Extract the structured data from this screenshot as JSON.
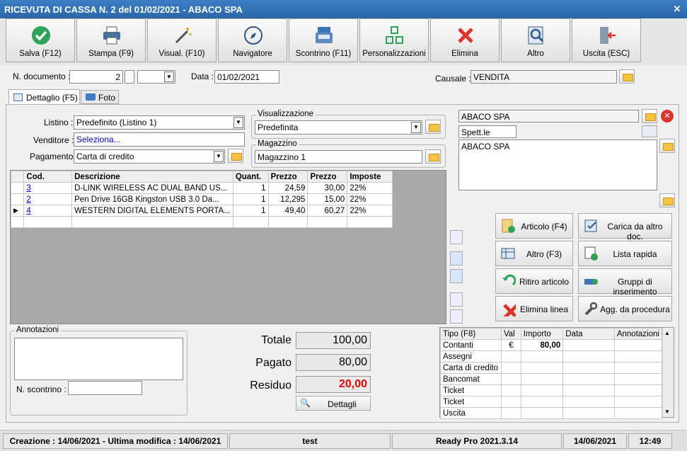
{
  "window": {
    "title": "RICEVUTA DI CASSA N. 2 del 01/02/2021 - ABACO SPA",
    "close": "✕"
  },
  "toolbar": [
    {
      "name": "save-button",
      "icon": "check-icon",
      "label": "Salva (F12)"
    },
    {
      "name": "print-button",
      "icon": "printer-icon",
      "label": "Stampa (F9)"
    },
    {
      "name": "visual-button",
      "icon": "wand-icon",
      "label": "Visual. (F10)"
    },
    {
      "name": "navigator-button",
      "icon": "compass-icon",
      "label": "Navigatore"
    },
    {
      "name": "receipt-button",
      "icon": "cash-register-icon",
      "label": "Scontrino (F11)"
    },
    {
      "name": "customize-button",
      "icon": "grid-icon",
      "label": "Personalizzazioni"
    },
    {
      "name": "delete-button",
      "icon": "x-icon",
      "label": "Elimina"
    },
    {
      "name": "other-button",
      "icon": "magnifier-icon",
      "label": "Altro"
    },
    {
      "name": "exit-button",
      "icon": "exit-door-icon",
      "label": "Uscita (ESC)"
    }
  ],
  "header": {
    "doc_label": "N. documento :",
    "doc_number": "2",
    "date_label": "Data :",
    "date": "01/02/2021",
    "causale_label": "Causale :",
    "causale": "VENDITA"
  },
  "tabs": [
    {
      "label": "Dettaglio (F5)"
    },
    {
      "label": "Foto"
    }
  ],
  "form": {
    "listino_label": "Listino :",
    "listino": "Predefinito (Listino 1)",
    "venditore_label": "Venditore :",
    "venditore": "Seleziona...",
    "pagamento_label": "Pagamento :",
    "pagamento": "Carta di credito",
    "visualizzazione_label": "Visualizzazione",
    "visualizzazione": "Predefinita",
    "magazzino_label": "Magazzino",
    "magazzino": "Magazzino 1"
  },
  "customer": {
    "name": "ABACO SPA",
    "salutation": "Spett.le",
    "address": "ABACO SPA"
  },
  "grid": {
    "headers": [
      "Cod.",
      "Descrizione",
      "Quant.",
      "Prezzo",
      "Prezzo",
      "Imposte"
    ],
    "rows": [
      {
        "code": "3",
        "desc": "D-LINK WIRELESS AC DUAL BAND US...",
        "qty": "1",
        "price": "24,59",
        "price2": "30,00",
        "tax": "22%"
      },
      {
        "code": "2",
        "desc": "Pen Drive 16GB  Kingston  USB 3.0 Da...",
        "qty": "1",
        "price": "12,295",
        "price2": "15,00",
        "tax": "22%"
      },
      {
        "code": "4",
        "desc": "WESTERN DIGITAL ELEMENTS PORTA...",
        "qty": "1",
        "price": "49,40",
        "price2": "60,27",
        "tax": "22%"
      }
    ]
  },
  "actions": [
    {
      "name": "add-article-button",
      "icon": "article-icon",
      "label": "Articolo (F4)"
    },
    {
      "name": "load-from-doc-button",
      "icon": "checklist-icon",
      "label": "Carica da altro doc."
    },
    {
      "name": "other-action-button",
      "icon": "table-icon",
      "label": "Altro (F3)"
    },
    {
      "name": "quick-list-button",
      "icon": "list-add-icon",
      "label": "Lista rapida"
    },
    {
      "name": "return-article-button",
      "icon": "return-icon",
      "label": "Ritiro articolo"
    },
    {
      "name": "insert-groups-button",
      "icon": "group-icon",
      "label": "Gruppi di inserimento"
    },
    {
      "name": "delete-line-button",
      "icon": "x-icon",
      "label": "Elimina linea"
    },
    {
      "name": "add-by-procedure-button",
      "icon": "wrench-icon",
      "label": "Agg. da procedura"
    }
  ],
  "notes": {
    "title": "Annotazioni",
    "scontrino_label": "N. scontrino :"
  },
  "totals": {
    "totale_label": "Totale",
    "totale": "100,00",
    "pagato_label": "Pagato",
    "pagato": "80,00",
    "residuo_label": "Residuo",
    "residuo": "20,00",
    "details_label": "Dettagli"
  },
  "payments": {
    "headers": [
      "Tipo (F8)",
      "Val",
      "Importo",
      "Data",
      "Annotazioni"
    ],
    "rows": [
      {
        "type": "Contanti",
        "val": "€",
        "amount": "80,00"
      },
      {
        "type": "Assegni",
        "val": "",
        "amount": ""
      },
      {
        "type": "Carta di credito",
        "val": "",
        "amount": ""
      },
      {
        "type": "Bancomat",
        "val": "",
        "amount": ""
      },
      {
        "type": "Ticket",
        "val": "",
        "amount": ""
      },
      {
        "type": "Ticket",
        "val": "",
        "amount": ""
      },
      {
        "type": "Uscita",
        "val": "",
        "amount": ""
      }
    ]
  },
  "status": {
    "created": "Creazione : 14/06/2021 - Ultima modifica : 14/06/2021",
    "user": "test",
    "version": "Ready Pro 2021.3.14",
    "date": "14/06/2021",
    "time": "12:49"
  },
  "colors": {
    "title_bar": "#2a66a8",
    "residuo": "#e00000",
    "link": "#0000cc"
  }
}
